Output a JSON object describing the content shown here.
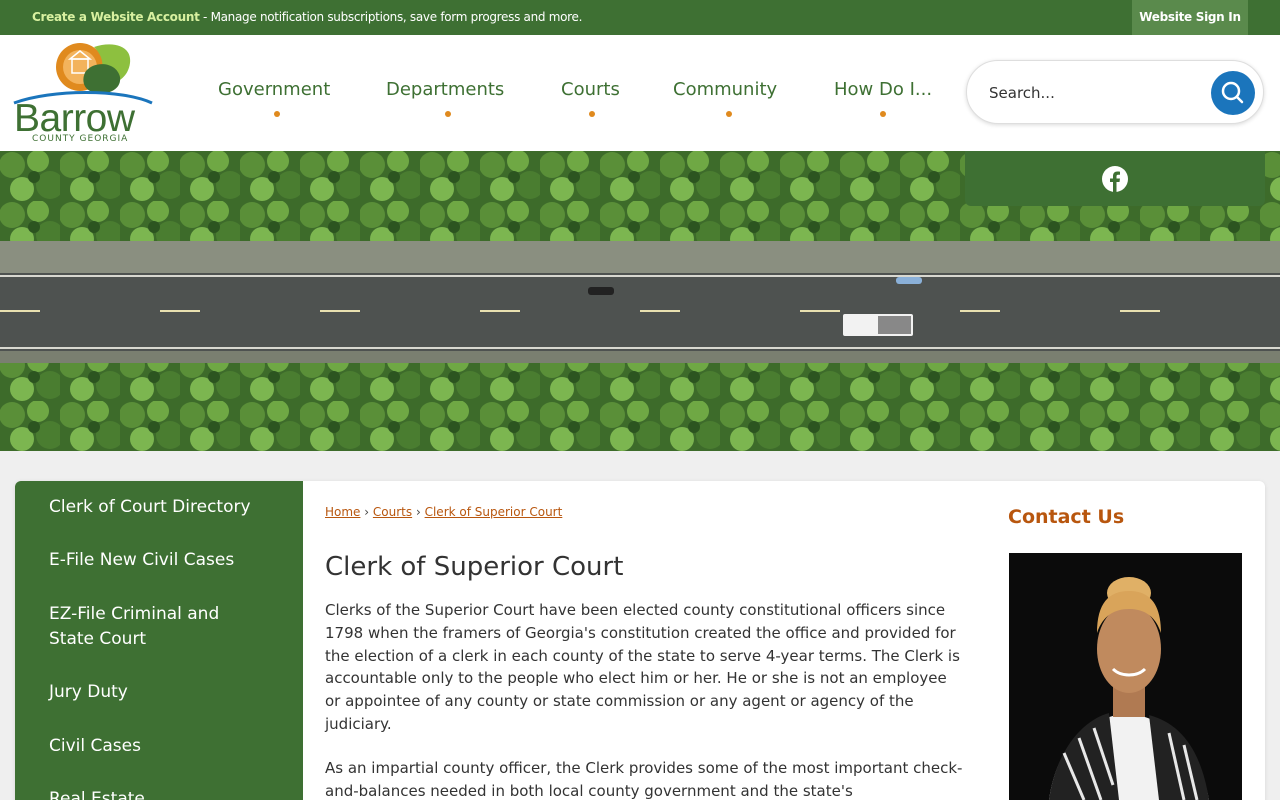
{
  "topbar": {
    "create_account": "Create a Website Account",
    "message": " - Manage notification subscriptions, save form progress and more.",
    "sign_in": "Website Sign In"
  },
  "logo": {
    "name": "Barrow",
    "sub": "COUNTY GEORGIA"
  },
  "nav": {
    "items": [
      {
        "label": "Government"
      },
      {
        "label": "Departments"
      },
      {
        "label": "Courts"
      },
      {
        "label": "Community"
      },
      {
        "label": "How Do I..."
      }
    ]
  },
  "search": {
    "placeholder": "Search..."
  },
  "social": {
    "icon": "facebook-icon"
  },
  "sidebar": {
    "items": [
      {
        "label": "Clerk of Court Directory"
      },
      {
        "label": "E-File New Civil Cases"
      },
      {
        "label": "EZ-File Criminal and State Court"
      },
      {
        "label": "Jury Duty"
      },
      {
        "label": "Civil Cases"
      },
      {
        "label": "Real Estate"
      }
    ]
  },
  "breadcrumb": {
    "home": "Home",
    "courts": "Courts",
    "current": "Clerk of Superior Court",
    "sep": "›"
  },
  "main": {
    "title": "Clerk of Superior Court",
    "paragraphs": [
      "Clerks of the Superior Court have been elected county constitutional officers since 1798 when the framers of Georgia's constitution created the office and provided for the election of a clerk in each county of the state to serve 4-year terms. The Clerk is accountable only to the people who elect him or her. He or she is not an employee or appointee of any county or state commission or any agent or agency of the judiciary.",
      "As an impartial county officer, the Clerk provides some of the most important check-and-balances needed in both local county government and the state's"
    ]
  },
  "contact": {
    "title": "Contact Us"
  },
  "colors": {
    "brand_green": "#3e7033",
    "accent_orange": "#e08a1e",
    "link_brown": "#b8560e",
    "search_blue": "#1b75bc"
  }
}
